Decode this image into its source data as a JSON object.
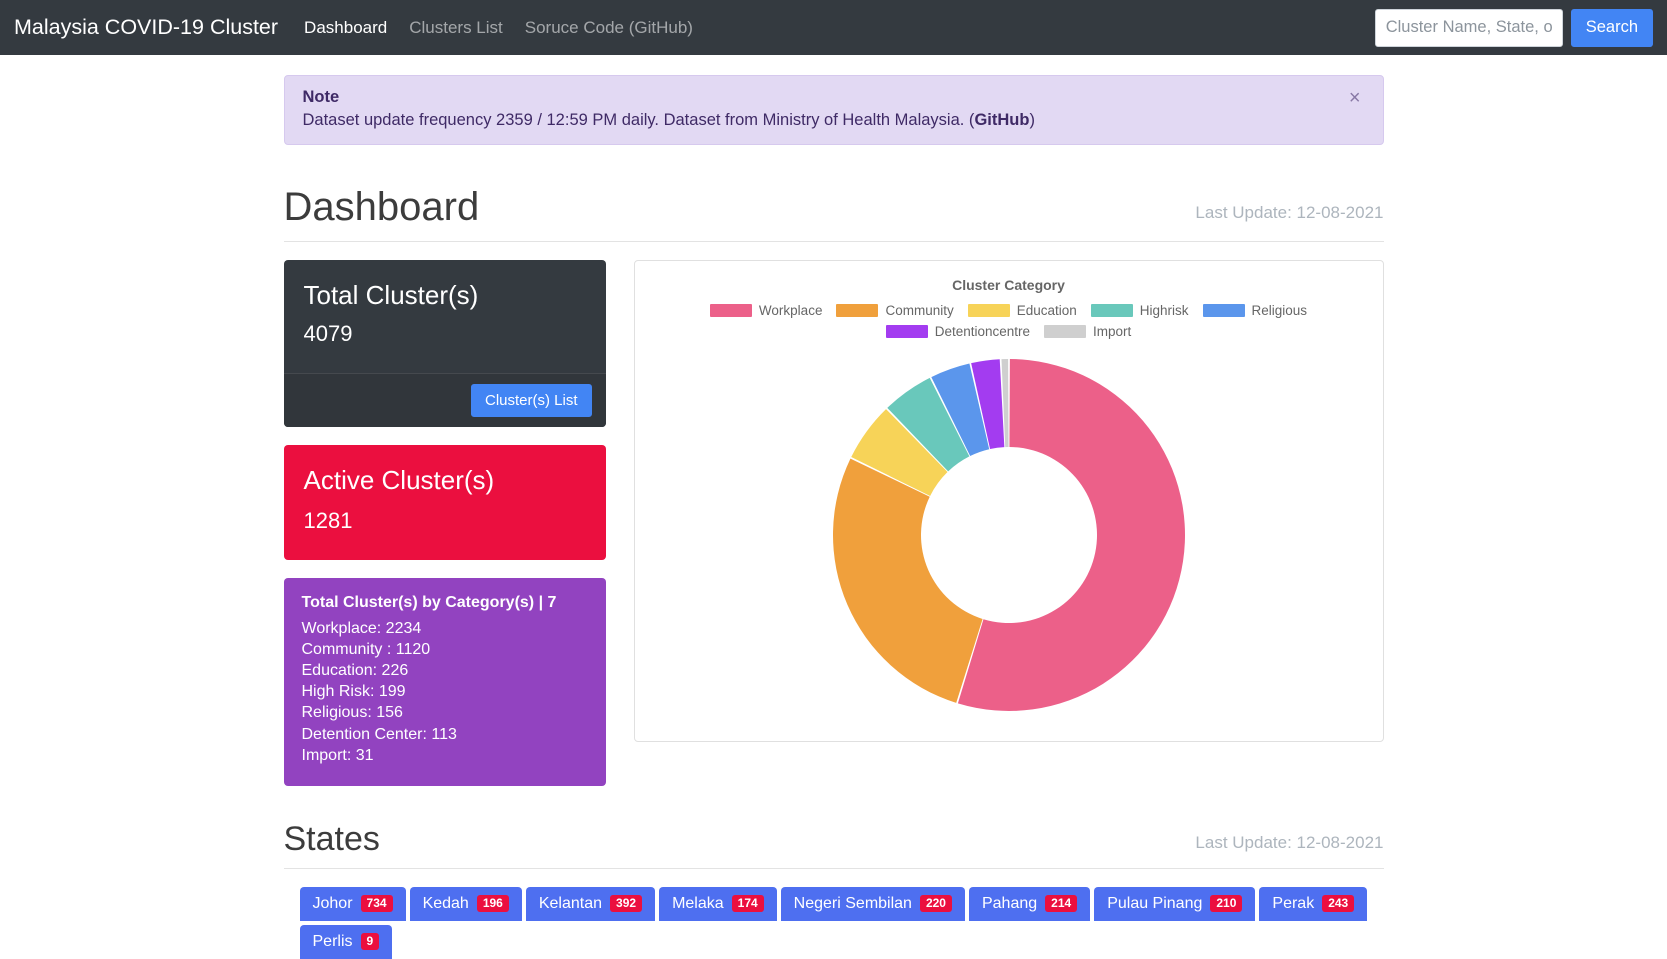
{
  "navbar": {
    "brand": "Malaysia COVID-19 Cluster",
    "links": [
      {
        "label": "Dashboard",
        "active": true
      },
      {
        "label": "Clusters List",
        "active": false
      },
      {
        "label": "Soruce Code (GitHub)",
        "active": false
      }
    ],
    "search": {
      "placeholder": "Cluster Name, State, or District",
      "value": "",
      "button_label": "Search"
    }
  },
  "alert": {
    "title": "Note",
    "text_before": "Dataset update frequency 2359 / 12:59 PM daily. Dataset from Ministry of Health Malaysia. (",
    "link_label": "GitHub",
    "text_after": ")",
    "close_label": "×"
  },
  "page": {
    "title": "Dashboard",
    "last_update": "Last Update: 12-08-2021"
  },
  "cards": {
    "total": {
      "title": "Total Cluster(s)",
      "value": "4079",
      "button_label": "Cluster(s) List"
    },
    "active": {
      "title": "Active Cluster(s)",
      "value": "1281"
    },
    "by_category": {
      "heading": "Total Cluster(s) by Category(s) | 7",
      "lines": [
        "Workplace: 2234",
        "Community : 1120",
        "Education: 226",
        "High Risk: 199",
        "Religious: 156",
        "Detention Center: 113",
        "Import: 31"
      ]
    }
  },
  "chart_data": {
    "type": "pie",
    "title": "Cluster Category",
    "variant": "donut",
    "legend_position": "top",
    "categories": [
      "Workplace",
      "Community",
      "Education",
      "Highrisk",
      "Religious",
      "Detentioncentre",
      "Import"
    ],
    "values": [
      2234,
      1120,
      226,
      199,
      156,
      113,
      31
    ],
    "colors": [
      "#ec6089",
      "#f0a03c",
      "#f7d358",
      "#69c8bb",
      "#5b96ec",
      "#a33cf0",
      "#cfcfcf"
    ],
    "total": 4079,
    "xlabel": "",
    "ylabel": ""
  },
  "states": {
    "title": "States",
    "last_update": "Last Update: 12-08-2021",
    "tabs": [
      {
        "label": "Johor",
        "count": "734"
      },
      {
        "label": "Kedah",
        "count": "196"
      },
      {
        "label": "Kelantan",
        "count": "392"
      },
      {
        "label": "Melaka",
        "count": "174"
      },
      {
        "label": "Negeri Sembilan",
        "count": "220"
      },
      {
        "label": "Pahang",
        "count": "214"
      },
      {
        "label": "Pulau Pinang",
        "count": "210"
      },
      {
        "label": "Perak",
        "count": "243"
      },
      {
        "label": "Perlis",
        "count": "9"
      }
    ]
  },
  "colors": {
    "navbar_bg": "#343a40",
    "primary": "#4285f4",
    "danger": "#eb0f3f",
    "purple": "#9243c0",
    "alert_bg": "#e2d9f3",
    "tab_blue": "#4e6ff0"
  }
}
